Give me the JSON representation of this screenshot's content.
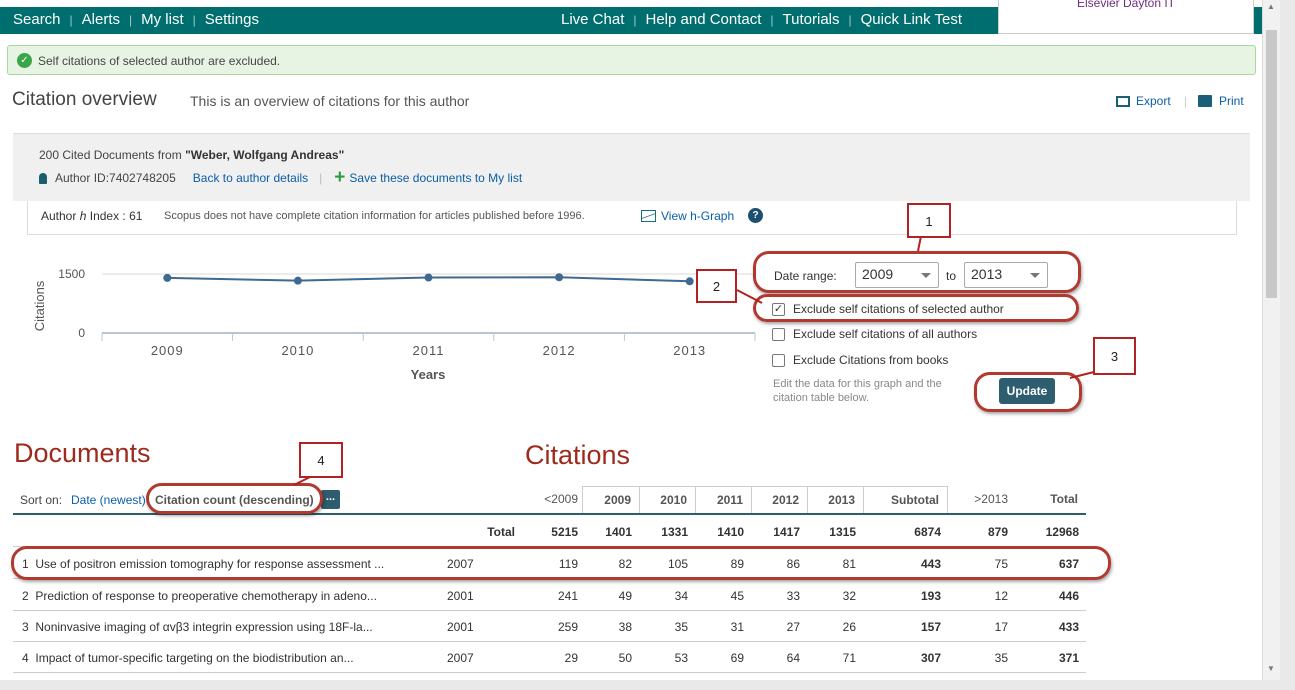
{
  "nav": {
    "left": [
      "Search",
      "Alerts",
      "My list",
      "Settings"
    ],
    "right": [
      "Live Chat",
      "Help and Contact",
      "Tutorials",
      "Quick Link Test"
    ],
    "institution": "Elsevier Dayton IT"
  },
  "banner": {
    "text": "Self citations of selected author are excluded."
  },
  "header": {
    "title": "Citation overview",
    "subtitle": "This is an overview of citations for this author",
    "export_label": "Export",
    "print_label": "Print"
  },
  "author_box": {
    "cited_prefix": "200 Cited Documents from",
    "author_name": "\"Weber, Wolfgang Andreas\"",
    "author_id": "Author ID:7402748205",
    "back_link": "Back to author details",
    "save_link": "Save these documents to My list"
  },
  "hindex": {
    "label_prefix": "Author",
    "label_h": "h",
    "label_suffix": "Index :",
    "value": "61",
    "note": "Scopus does not have complete citation information for articles published before 1996.",
    "graph_link": "View h-Graph",
    "help": "?"
  },
  "controls": {
    "date_range_label": "Date range:",
    "from_year": "2009",
    "to_label": "to",
    "to_year": "2013",
    "checkboxes": [
      {
        "label": "Exclude self citations of selected author",
        "checked": true
      },
      {
        "label": "Exclude self citations of all authors",
        "checked": false
      },
      {
        "label": "Exclude Citations from books",
        "checked": false
      }
    ],
    "edit_note": "Edit the data for this graph and the citation table below.",
    "update_label": "Update"
  },
  "callouts": [
    "1",
    "2",
    "3",
    "4"
  ],
  "chart_data": {
    "type": "line",
    "x": [
      "2009",
      "2010",
      "2011",
      "2012",
      "2013"
    ],
    "series": [
      {
        "values": [
          1401,
          1331,
          1410,
          1417,
          1315
        ]
      }
    ],
    "ylabel": "Citations",
    "xlabel": "Years",
    "yticks": [
      "0",
      "1500"
    ],
    "ylim": [
      0,
      1500
    ],
    "grid": true
  },
  "documents": {
    "heading": "Documents",
    "citations_heading": "Citations",
    "sort_label": "Sort on:",
    "sort_date": "Date (newest)",
    "sort_citation": "Citation count (descending)",
    "sort_more": "...",
    "columns": [
      "<2009",
      "2009",
      "2010",
      "2011",
      "2012",
      "2013",
      "Subtotal",
      ">2013",
      "Total"
    ],
    "total_row": {
      "label": "Total",
      "values": [
        "5215",
        "1401",
        "1331",
        "1410",
        "1417",
        "1315",
        "6874",
        "879",
        "12968"
      ]
    },
    "rows": [
      {
        "num": "1",
        "title": "Use of positron emission tomography for response assessment ...",
        "year": "2007",
        "values": [
          "119",
          "82",
          "105",
          "89",
          "86",
          "81",
          "443",
          "75",
          "637"
        ]
      },
      {
        "num": "2",
        "title": "Prediction of response to preoperative chemotherapy in adeno...",
        "year": "2001",
        "values": [
          "241",
          "49",
          "34",
          "45",
          "33",
          "32",
          "193",
          "12",
          "446"
        ]
      },
      {
        "num": "3",
        "title": "Noninvasive imaging of αvβ3 integrin expression using 18F-la...",
        "year": "2001",
        "values": [
          "259",
          "38",
          "35",
          "31",
          "27",
          "26",
          "157",
          "17",
          "433"
        ]
      },
      {
        "num": "4",
        "title": "Impact of tumor-specific targeting on the biodistribution an...",
        "year": "2007",
        "values": [
          "29",
          "50",
          "53",
          "69",
          "64",
          "71",
          "307",
          "35",
          "371"
        ]
      }
    ]
  }
}
